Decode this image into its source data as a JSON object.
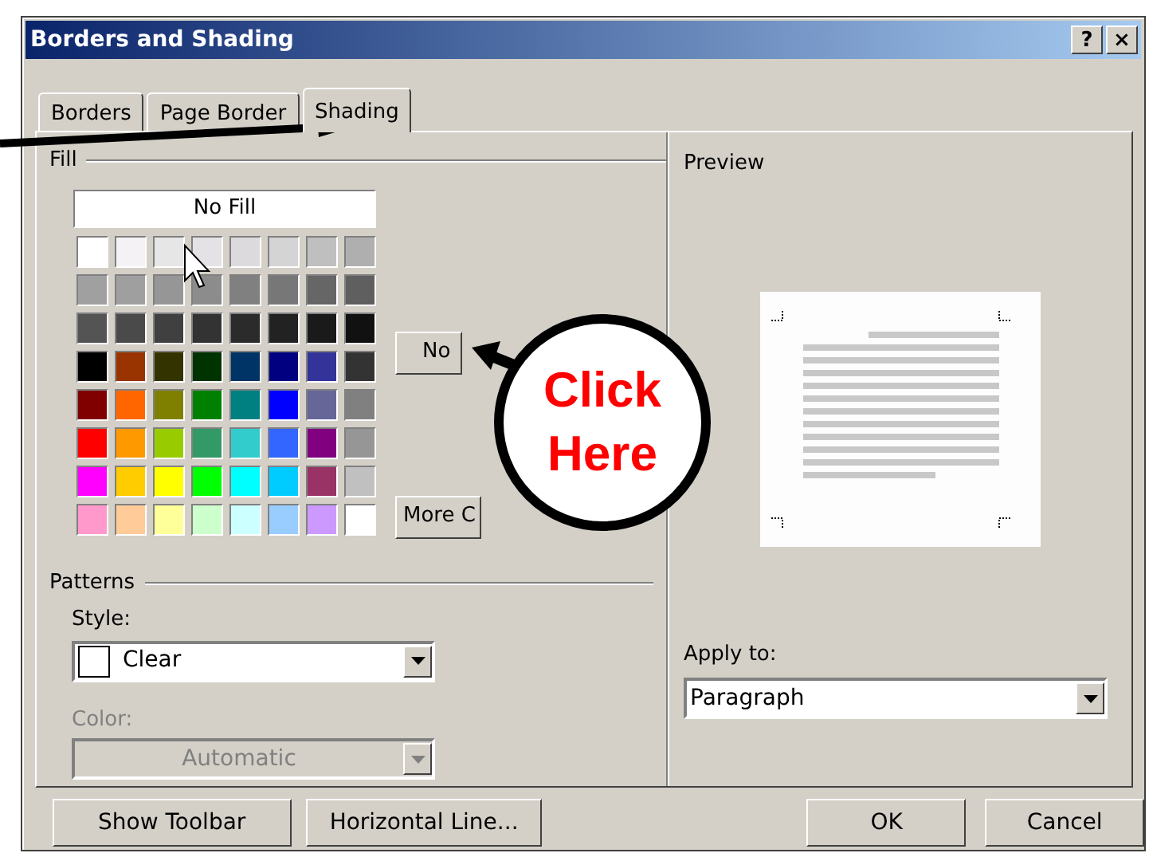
{
  "window": {
    "title": "Borders and Shading",
    "help_button": "?",
    "close_button": "×"
  },
  "tabs": [
    {
      "label": "Borders",
      "selected": false
    },
    {
      "label": "Page Border",
      "selected": false
    },
    {
      "label": "Shading",
      "selected": true
    }
  ],
  "fill": {
    "label": "Fill",
    "no_fill_button": "No Fill",
    "swatch_rows": [
      [
        {
          "color": "#ffffff"
        },
        {
          "color": "#f4f2f4"
        },
        {
          "color": "#e6e6e6"
        },
        {
          "color": "#e4e2e4"
        },
        {
          "color": "#dcdadc"
        },
        {
          "color": "#d4d4d4"
        },
        {
          "color": "#c0bfc0"
        },
        {
          "color": "#b0afb0"
        }
      ],
      [
        {
          "color": "#a0a0a0"
        },
        {
          "color": "#a09fa0"
        },
        {
          "color": "#969696"
        },
        {
          "color": "#8c8c8c"
        },
        {
          "color": "#808080"
        },
        {
          "color": "#777777"
        },
        {
          "color": "#666666"
        },
        {
          "color": "#5f5f5f"
        }
      ],
      [
        {
          "color": "#545454"
        },
        {
          "color": "#4a4a4a"
        },
        {
          "color": "#404040"
        },
        {
          "color": "#333333"
        },
        {
          "color": "#2b2b2b"
        },
        {
          "color": "#222222"
        },
        {
          "color": "#1a1a1a"
        },
        {
          "color": "#111111"
        }
      ],
      [
        {
          "color": "#000000"
        },
        {
          "color": "#993300"
        },
        {
          "color": "#333300"
        },
        {
          "color": "#003300"
        },
        {
          "color": "#003366"
        },
        {
          "color": "#000080"
        },
        {
          "color": "#333399"
        },
        {
          "color": "#333333"
        }
      ],
      [
        {
          "color": "#800000"
        },
        {
          "color": "#ff6600"
        },
        {
          "color": "#808000"
        },
        {
          "color": "#008000"
        },
        {
          "color": "#008080"
        },
        {
          "color": "#0000ff"
        },
        {
          "color": "#666699"
        },
        {
          "color": "#808080"
        }
      ],
      [
        {
          "color": "#ff0000"
        },
        {
          "color": "#ff9900"
        },
        {
          "color": "#99cc00"
        },
        {
          "color": "#339966"
        },
        {
          "color": "#33cccc"
        },
        {
          "color": "#3366ff"
        },
        {
          "color": "#800080"
        },
        {
          "color": "#969696"
        }
      ],
      [
        {
          "color": "#ff00ff"
        },
        {
          "color": "#ffcc00"
        },
        {
          "color": "#ffff00"
        },
        {
          "color": "#00ff00"
        },
        {
          "color": "#00ffff"
        },
        {
          "color": "#00ccff"
        },
        {
          "color": "#993366"
        },
        {
          "color": "#c0c0c0"
        }
      ],
      [
        {
          "color": "#ff99cc"
        },
        {
          "color": "#ffcc99"
        },
        {
          "color": "#ffff99"
        },
        {
          "color": "#ccffcc"
        },
        {
          "color": "#ccffff"
        },
        {
          "color": "#99ccff"
        },
        {
          "color": "#cc99ff"
        },
        {
          "color": "#ffffff"
        }
      ]
    ],
    "no_color_button": "No",
    "more_colors_button": "More C"
  },
  "patterns": {
    "label": "Patterns",
    "style_label": "Style:",
    "style_value": "Clear",
    "color_label": "Color:",
    "color_value": "Automatic",
    "color_disabled": true
  },
  "preview": {
    "label": "Preview",
    "apply_to_label": "Apply to:",
    "apply_to_value": "Paragraph"
  },
  "buttons": [
    {
      "label": "Show Toolbar"
    },
    {
      "label": "Horizontal Line..."
    },
    {
      "label": "OK"
    },
    {
      "label": "Cancel"
    }
  ],
  "annotation": {
    "callout": "Click Here"
  }
}
